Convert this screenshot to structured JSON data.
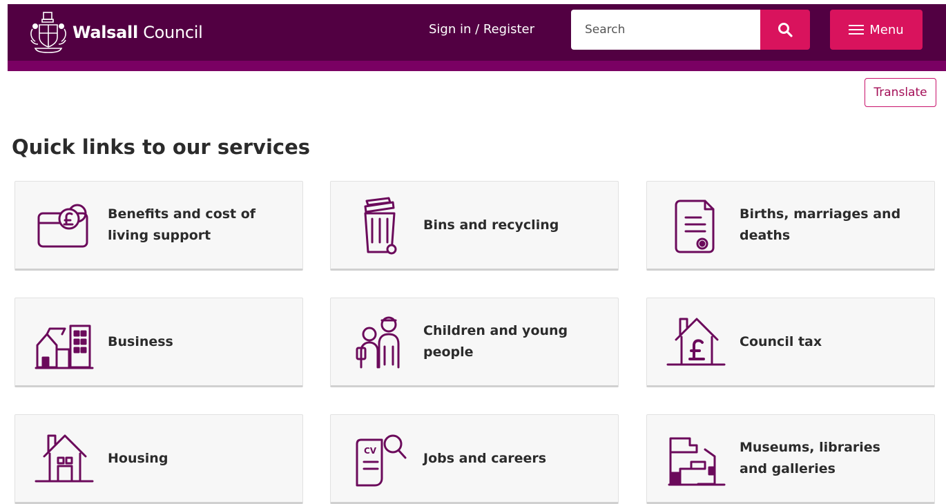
{
  "header": {
    "logo_bold": "Walsall",
    "logo_regular": "Council",
    "sign_in": "Sign in / Register",
    "search_placeholder": "Search",
    "menu_label": "Menu"
  },
  "translate_label": "Translate",
  "page_title": "Quick links to our services",
  "colors": {
    "header": "#520042",
    "accent": "#d9135d",
    "icon": "#6b0a5b"
  },
  "services": [
    {
      "label": "Benefits and cost of living support",
      "icon": "money-icon"
    },
    {
      "label": "Bins and recycling",
      "icon": "bin-icon"
    },
    {
      "label": "Births, marriages and deaths",
      "icon": "certificate-icon"
    },
    {
      "label": "Business",
      "icon": "business-buildings-icon"
    },
    {
      "label": "Children and young people",
      "icon": "children-icon"
    },
    {
      "label": "Council tax",
      "icon": "house-pound-icon"
    },
    {
      "label": "Housing",
      "icon": "house-icon"
    },
    {
      "label": "Jobs and careers",
      "icon": "cv-search-icon"
    },
    {
      "label": "Museums, libraries and galleries",
      "icon": "museum-icon"
    }
  ]
}
